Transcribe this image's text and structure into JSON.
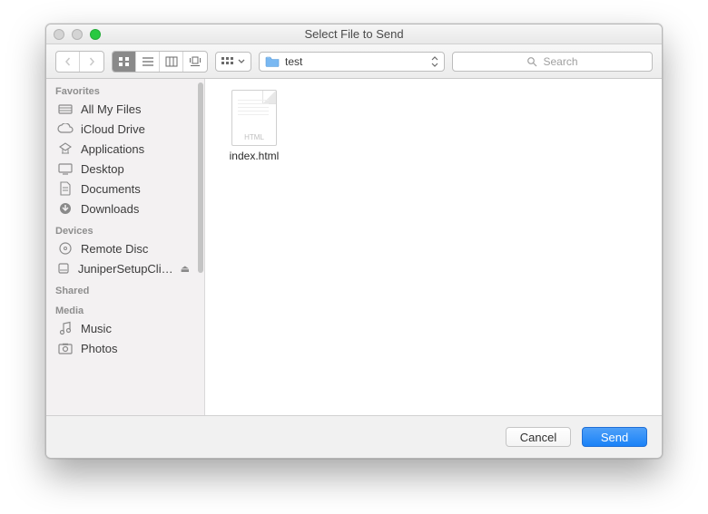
{
  "window": {
    "title": "Select File to Send"
  },
  "toolbar": {
    "path": "test",
    "search_placeholder": "Search"
  },
  "sidebar": {
    "sections": [
      {
        "label": "Favorites",
        "items": [
          {
            "icon": "all-my-files",
            "label": "All My Files"
          },
          {
            "icon": "icloud",
            "label": "iCloud Drive"
          },
          {
            "icon": "applications",
            "label": "Applications"
          },
          {
            "icon": "desktop",
            "label": "Desktop"
          },
          {
            "icon": "documents",
            "label": "Documents"
          },
          {
            "icon": "downloads",
            "label": "Downloads"
          }
        ]
      },
      {
        "label": "Devices",
        "items": [
          {
            "icon": "remote-disc",
            "label": "Remote Disc"
          },
          {
            "icon": "disk",
            "label": "JuniperSetupCli…",
            "eject": true
          }
        ]
      },
      {
        "label": "Shared",
        "items": []
      },
      {
        "label": "Media",
        "items": [
          {
            "icon": "music",
            "label": "Music"
          },
          {
            "icon": "photos",
            "label": "Photos"
          }
        ]
      }
    ]
  },
  "content": {
    "files": [
      {
        "name": "index.html",
        "badge": "HTML"
      }
    ]
  },
  "footer": {
    "cancel": "Cancel",
    "send": "Send"
  }
}
